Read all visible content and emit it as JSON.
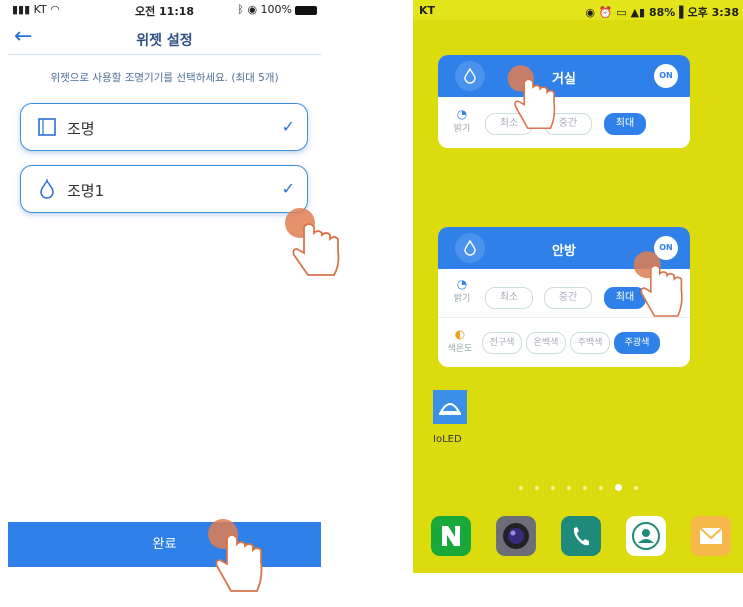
{
  "left_phone": {
    "status": {
      "carrier": "KT",
      "time": "오전 11:18",
      "battery": "100%"
    },
    "title": "위젯 설정",
    "instruction": "위젯으로 사용할 조명기기를 선택하세요. (최대 5개)",
    "devices": [
      {
        "name": "조명",
        "icon": "panel-light-icon",
        "checked": true
      },
      {
        "name": "조명1",
        "icon": "bulb-drop-icon",
        "checked": true
      }
    ],
    "done_label": "완료"
  },
  "right_phone": {
    "status": {
      "carrier": "KT",
      "right_text": "88% ▌오후 3:38"
    },
    "widgets": [
      {
        "name": "거실",
        "on_label": "ON",
        "brightness_label": "밝기",
        "brightness_options": [
          "최소",
          "중간",
          "최대"
        ],
        "brightness_selected": "최대"
      },
      {
        "name": "안방",
        "on_label": "ON",
        "brightness_label": "밝기",
        "brightness_options": [
          "최소",
          "중간",
          "최대"
        ],
        "brightness_selected": "최대",
        "color_label": "색온도",
        "color_options": [
          "전구색",
          "온백색",
          "주백색",
          "주광색"
        ],
        "color_selected": "주광색"
      }
    ],
    "app_label": "IoLED",
    "page_dots": 8,
    "active_dot": 6,
    "dock": [
      "naver-app-icon",
      "camera-app-icon",
      "phone-app-icon",
      "contacts-app-icon",
      "email-app-icon"
    ]
  },
  "colors": {
    "accent": "#2f80e8",
    "home_bg": "#dbdb0e",
    "touch_hand": "#e07e52"
  }
}
